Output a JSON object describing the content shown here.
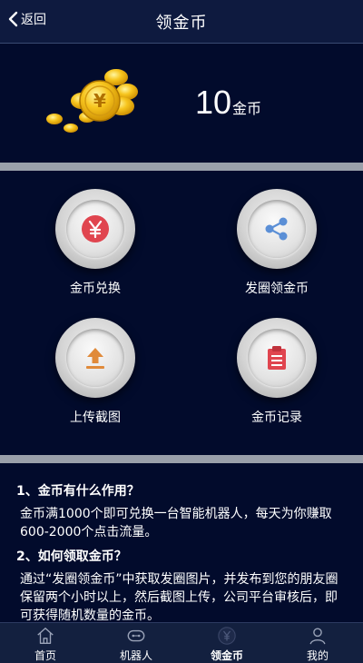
{
  "header": {
    "back_label": "返回",
    "title": "领金币"
  },
  "balance": {
    "amount": "10",
    "unit": "金币"
  },
  "actions": [
    {
      "label": "金币兑换",
      "icon": "yen-icon"
    },
    {
      "label": "发圈领金币",
      "icon": "share-icon"
    },
    {
      "label": "上传截图",
      "icon": "upload-icon"
    },
    {
      "label": "金币记录",
      "icon": "clipboard-icon"
    }
  ],
  "faq": [
    {
      "question": "1、金币有什么作用？",
      "answer": "金币满1000个即可兑换一台智能机器人，每天为你赚取600-2000个点击流量。"
    },
    {
      "question": "2、如何领取金币？",
      "answer": "通过“发圈领金币”中获取发圈图片，并发布到您的朋友圈保留两个小时以上，然后截图上传，公司平台审核后，即可获得随机数量的金币。"
    }
  ],
  "tabbar": [
    {
      "label": "首页",
      "icon": "home-icon"
    },
    {
      "label": "机器人",
      "icon": "robot-icon"
    },
    {
      "label": "领金币",
      "icon": "yen-coin-icon",
      "active": true
    },
    {
      "label": "我的",
      "icon": "user-icon"
    }
  ],
  "colors": {
    "background": "#020b2c",
    "header": "#0e1a3f",
    "separator": "#9aa0aa",
    "accent_red": "#e0454f",
    "accent_blue": "#5b8fd6",
    "accent_orange": "#e08a3a"
  }
}
